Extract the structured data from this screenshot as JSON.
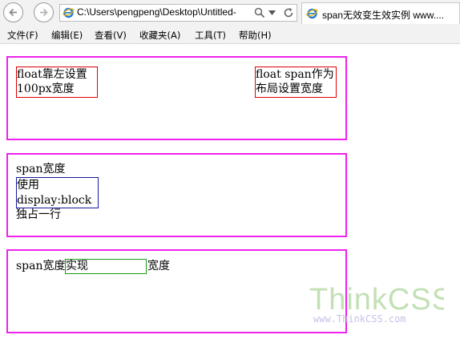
{
  "browser": {
    "address": "C:\\Users\\pengpeng\\Desktop\\Untitled-",
    "tab_title": "span无效变生效实例 www....",
    "menu": [
      "文件(F)",
      "编辑(E)",
      "查看(V)",
      "收藏夹(A)",
      "工具(T)",
      "帮助(H)"
    ]
  },
  "page": {
    "box1": {
      "left_line1": "float靠左设置",
      "left_line2": "100px宽度",
      "right_line1": "float span作为",
      "right_line2": "布局设置宽度"
    },
    "box2": {
      "line1": "span宽度",
      "block_line1": "使用",
      "block_line2": "display:block",
      "line_after": "独占一行"
    },
    "box3": {
      "before": "span宽度",
      "span": "实现",
      "after": "宽度"
    },
    "watermark": {
      "brand": "ThinkCSS",
      "url": "www.ThinkCSS.com"
    }
  },
  "colors": {
    "box_border": "#ee22ee",
    "red_span": "#dd0000",
    "blue_span": "#1818a0",
    "green_span": "#1a9a1a"
  },
  "icons": {
    "back": "back-arrow-icon",
    "forward": "forward-arrow-icon",
    "page": "ie-logo-icon",
    "search": "search-icon",
    "dropdown": "chevron-down-icon",
    "refresh": "refresh-icon"
  }
}
